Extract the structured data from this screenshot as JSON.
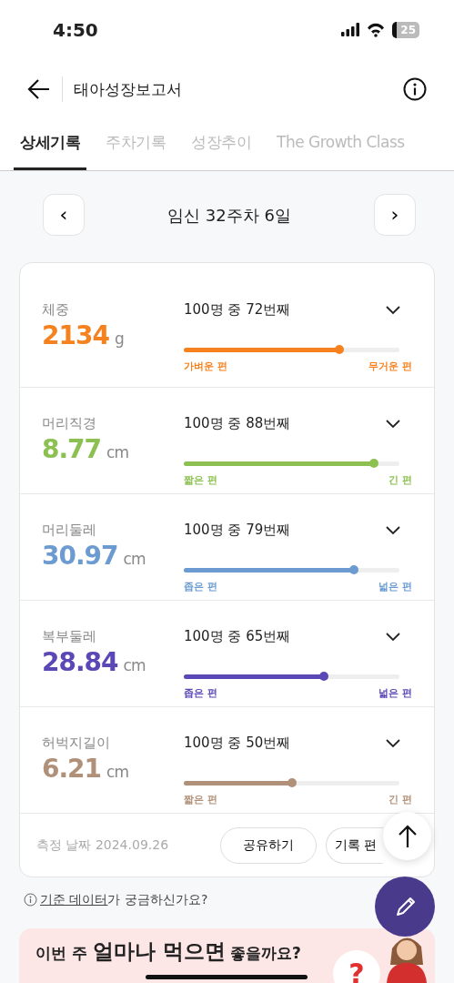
{
  "status_bar": {
    "time": "4:50",
    "battery": "25"
  },
  "header": {
    "title": "태아성장보고서"
  },
  "tabs": [
    {
      "label": "상세기록",
      "selected": true
    },
    {
      "label": "주차기록",
      "selected": false
    },
    {
      "label": "성장추이",
      "selected": false
    },
    {
      "label": "The Growth Class",
      "selected": false
    }
  ],
  "date_nav": {
    "prev": "‹",
    "label": "임신 32주차 6일",
    "next": "›"
  },
  "metrics": [
    {
      "label": "체중",
      "value": "2134",
      "unit": "g",
      "rank": "100명 중 72번째",
      "left_label": "가벼운 편",
      "right_label": "무거운 편",
      "level": 0.72,
      "color": "#f5821f",
      "expanded": false
    },
    {
      "label": "머리직경",
      "value": "8.77",
      "unit": "cm",
      "rank": "100명 중 88번째",
      "left_label": "짧은 편",
      "right_label": "긴 편",
      "level": 0.88,
      "color": "#8cc152",
      "expanded": false
    },
    {
      "label": "머리둘레",
      "value": "30.97",
      "unit": "cm",
      "rank": "100명 중 79번째",
      "left_label": "좁은 편",
      "right_label": "넓은 편",
      "level": 0.79,
      "color": "#6b9bd1",
      "expanded": false
    },
    {
      "label": "복부둘레",
      "value": "28.84",
      "unit": "cm",
      "rank": "100명 중 65번째",
      "left_label": "좁은 편",
      "right_label": "넓은 편",
      "level": 0.65,
      "color": "#5b47b5",
      "expanded": false
    },
    {
      "label": "허벅지길이",
      "value": "6.21",
      "unit": "cm",
      "rank": "100명 중 50번째",
      "left_label": "짧은 편",
      "right_label": "긴 편",
      "level": 0.5,
      "color": "#b09078",
      "expanded": false
    }
  ],
  "card_footer": {
    "date": "측정 날짜 2024.09.26",
    "buttons": [
      "공유하기",
      "기록 편"
    ]
  },
  "info_line": {
    "link": "기준 데이터",
    "text": "가 궁금하신가요?"
  },
  "banner": {
    "parts": [
      {
        "text": "이번 주",
        "large": false
      },
      {
        "text": "얼마나 먹으면",
        "large": true
      },
      {
        "text": "좋을까요?",
        "large": false
      }
    ],
    "badge": "?"
  }
}
